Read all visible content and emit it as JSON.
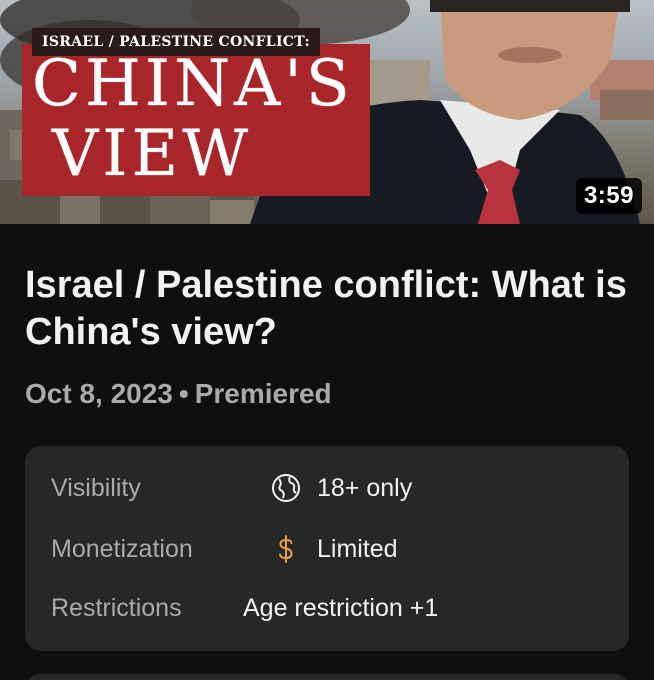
{
  "thumbnail": {
    "banner_small": "ISRAEL / PALESTINE CONFLICT:",
    "banner_line1": "CHINA'S",
    "banner_line2": "VIEW",
    "duration": "3:59",
    "banner_color": "#a8252a"
  },
  "video": {
    "title": "Israel / Palestine conflict: What is China's view?",
    "date": "Oct 8, 2023",
    "separator": "•",
    "status": "Premiered"
  },
  "details": {
    "visibility": {
      "label": "Visibility",
      "icon": "globe-icon",
      "value": "18+ only"
    },
    "monetization": {
      "label": "Monetization",
      "icon": "dollar-icon",
      "icon_color": "#e8a33d",
      "value": "Limited"
    },
    "restrictions": {
      "label": "Restrictions",
      "value": "Age restriction +1"
    }
  }
}
